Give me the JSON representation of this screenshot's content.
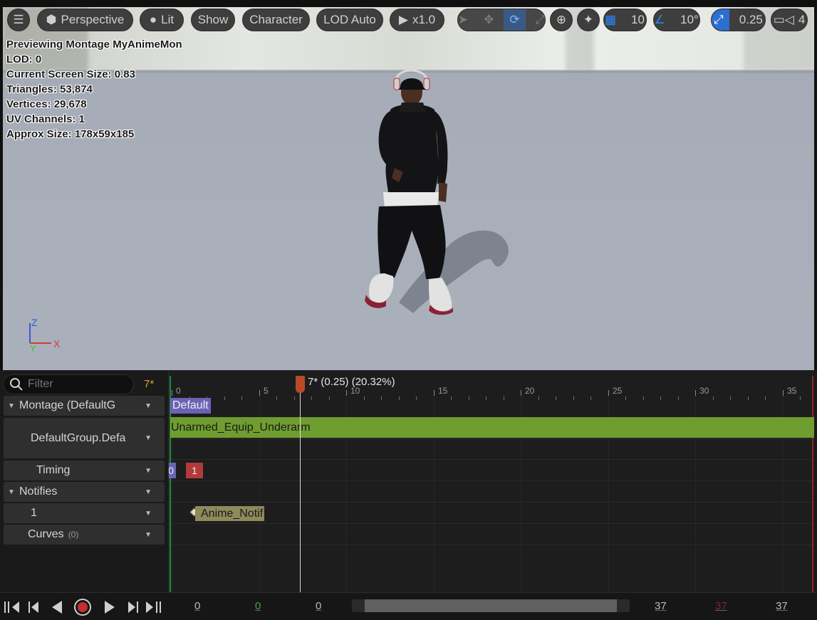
{
  "toolbar": {
    "perspective": "Perspective",
    "lit": "Lit",
    "show": "Show",
    "character": "Character",
    "lod": "LOD Auto",
    "speed": "x1.0",
    "grid_snap": "10",
    "angle_snap": "10°",
    "scale_snap": "0.25",
    "camera_speed": "4"
  },
  "stats": [
    "Previewing Montage MyAnimeMon",
    "LOD: 0",
    "Current Screen Size: 0.83",
    "Triangles: 53,874",
    "Vertices: 29,678",
    "UV Channels: 1",
    "Approx Size: 178x59x185"
  ],
  "axis": {
    "z": "Z",
    "y": "Y",
    "x": "X"
  },
  "filter": {
    "placeholder": "Filter",
    "count": "7*"
  },
  "tracks": {
    "montage": "Montage (DefaultG",
    "group": "DefaultGroup.Defa",
    "timing": "Timing",
    "notifies": "Notifies",
    "notify_track": "1",
    "curves": "Curves",
    "curves_count": "(0)"
  },
  "ruler": {
    "labels": [
      "0",
      "5",
      "10",
      "15",
      "20",
      "25",
      "30",
      "35"
    ],
    "scrub_label": "7* (0.25) (20.32%)"
  },
  "timeline": {
    "section": "Default",
    "anim_segment": "Unarmed_Equip_Underarm",
    "timing_0": "0",
    "timing_1": "1",
    "notify": "Anime_Notif"
  },
  "transport": {
    "start": "0",
    "start_green": "0",
    "current": "0",
    "end": "37",
    "end_red": "37",
    "length": "37"
  },
  "colors": {
    "accent": "#2a6fd1",
    "section": "#6a63b5",
    "anim_segment": "#6f9d2f",
    "notify": "#8e8a5c",
    "scrub": "#b84a28",
    "filter_count": "#e0a030"
  }
}
